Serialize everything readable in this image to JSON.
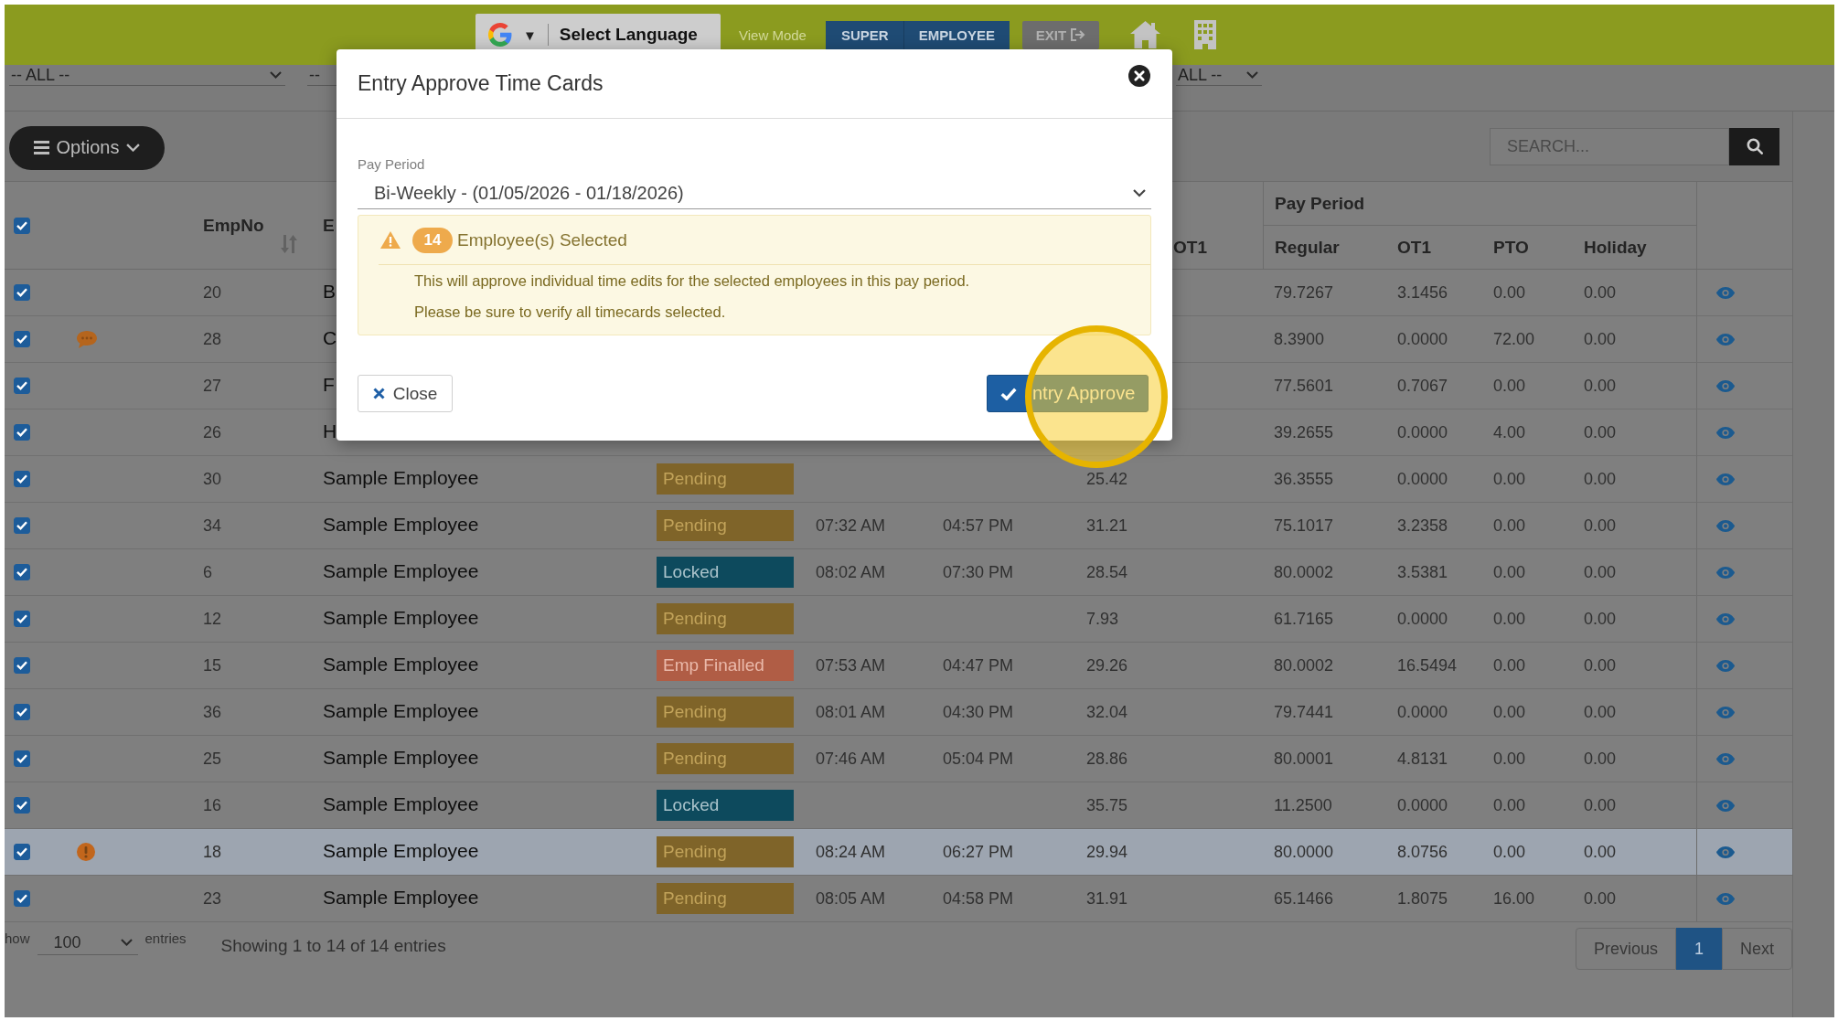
{
  "top_bar": {
    "language_select": {
      "caret": "▼",
      "label": "Select Language"
    },
    "view_mode": {
      "label": "View Mode",
      "options": [
        "SUPER",
        "EMPLOYEE"
      ]
    },
    "exit_button": "EXIT"
  },
  "filters": [
    {
      "value": "-- ALL --",
      "caret": true
    },
    {
      "value": "--",
      "caret": false
    },
    {
      "value": "ALL --",
      "caret": true
    }
  ],
  "toolbar": {
    "options_button": "Options",
    "search": {
      "placeholder": "SEARCH..."
    }
  },
  "table": {
    "select_all_checked": true,
    "headers": {
      "emp_no": "EmpNo",
      "employee": "E",
      "ot1": "OT1",
      "group": "Pay Period",
      "pay_period": [
        "Regular",
        "OT1",
        "PTO",
        "Holiday"
      ]
    },
    "rows": [
      {
        "checked": true,
        "highlighted": false,
        "emp_no": "20",
        "name": "B",
        "regular": "79.7267",
        "ot1": "3.1456",
        "pto": "0.00",
        "holiday": "0.00"
      },
      {
        "checked": true,
        "highlighted": false,
        "indicator": {
          "kind": "comment"
        },
        "emp_no": "28",
        "name": "C",
        "regular": "8.3900",
        "ot1": "0.0000",
        "pto": "72.00",
        "holiday": "0.00"
      },
      {
        "checked": true,
        "highlighted": false,
        "emp_no": "27",
        "name": "F",
        "regular": "77.5601",
        "ot1": "0.7067",
        "pto": "0.00",
        "holiday": "0.00"
      },
      {
        "checked": true,
        "highlighted": false,
        "emp_no": "26",
        "name": "H",
        "regular": "39.2655",
        "ot1": "0.0000",
        "pto": "4.00",
        "holiday": "0.00"
      },
      {
        "checked": true,
        "highlighted": false,
        "emp_no": "30",
        "name": "Sample Employee",
        "status": {
          "kind": "pending",
          "label": "Pending"
        },
        "hours": "25.42",
        "regular": "36.3555",
        "ot1": "0.0000",
        "pto": "0.00",
        "holiday": "0.00"
      },
      {
        "checked": true,
        "highlighted": false,
        "emp_no": "34",
        "name": "Sample Employee",
        "status": {
          "kind": "pending",
          "label": "Pending"
        },
        "time_in": "07:32 AM",
        "time_out": "04:57 PM",
        "hours": "31.21",
        "regular": "75.1017",
        "ot1": "3.2358",
        "pto": "0.00",
        "holiday": "0.00"
      },
      {
        "checked": true,
        "highlighted": false,
        "emp_no": "6",
        "name": "Sample Employee",
        "status": {
          "kind": "locked",
          "label": "Locked"
        },
        "time_in": "08:02 AM",
        "time_out": "07:30 PM",
        "hours": "28.54",
        "regular": "80.0002",
        "ot1": "3.5381",
        "pto": "0.00",
        "holiday": "0.00"
      },
      {
        "checked": true,
        "highlighted": false,
        "emp_no": "12",
        "name": "Sample Employee",
        "status": {
          "kind": "pending",
          "label": "Pending"
        },
        "hours": "7.93",
        "regular": "61.7165",
        "ot1": "0.0000",
        "pto": "0.00",
        "holiday": "0.00"
      },
      {
        "checked": true,
        "highlighted": false,
        "emp_no": "15",
        "name": "Sample Employee",
        "status": {
          "kind": "finalled",
          "label": "Emp Finalled"
        },
        "time_in": "07:53 AM",
        "time_out": "04:47 PM",
        "hours": "29.26",
        "regular": "80.0002",
        "ot1": "16.5494",
        "pto": "0.00",
        "holiday": "0.00"
      },
      {
        "checked": true,
        "highlighted": false,
        "emp_no": "36",
        "name": "Sample Employee",
        "status": {
          "kind": "pending",
          "label": "Pending"
        },
        "time_in": "08:01 AM",
        "time_out": "04:30 PM",
        "hours": "32.04",
        "regular": "79.7441",
        "ot1": "0.0000",
        "pto": "0.00",
        "holiday": "0.00"
      },
      {
        "checked": true,
        "highlighted": false,
        "emp_no": "25",
        "name": "Sample Employee",
        "status": {
          "kind": "pending",
          "label": "Pending"
        },
        "time_in": "07:46 AM",
        "time_out": "05:04 PM",
        "hours": "28.86",
        "regular": "80.0001",
        "ot1": "4.8131",
        "pto": "0.00",
        "holiday": "0.00"
      },
      {
        "checked": true,
        "highlighted": false,
        "emp_no": "16",
        "name": "Sample Employee",
        "status": {
          "kind": "locked",
          "label": "Locked"
        },
        "hours": "35.75",
        "regular": "11.2500",
        "ot1": "0.0000",
        "pto": "0.00",
        "holiday": "0.00"
      },
      {
        "checked": true,
        "highlighted": true,
        "indicator": {
          "kind": "alert"
        },
        "emp_no": "18",
        "name": "Sample Employee",
        "status": {
          "kind": "pending",
          "label": "Pending"
        },
        "time_in": "08:24 AM",
        "time_out": "06:27 PM",
        "hours": "29.94",
        "regular": "80.0000",
        "ot1": "8.0756",
        "pto": "0.00",
        "holiday": "0.00"
      },
      {
        "checked": true,
        "highlighted": false,
        "emp_no": "23",
        "name": "Sample Employee",
        "status": {
          "kind": "pending",
          "label": "Pending"
        },
        "time_in": "08:05 AM",
        "time_out": "04:58 PM",
        "hours": "31.91",
        "regular": "65.1466",
        "ot1": "1.8075",
        "pto": "16.00",
        "holiday": "0.00"
      }
    ]
  },
  "footer": {
    "show_label": "how",
    "page_size": "100",
    "entries_label": "entries",
    "info": "Showing 1 to 14 of 14 entries",
    "pagination": [
      {
        "label": "Previous",
        "selected": false
      },
      {
        "label": "1",
        "selected": true
      },
      {
        "label": "Next",
        "selected": false
      }
    ]
  },
  "modal": {
    "title": "Entry Approve Time Cards",
    "pay_period": {
      "label": "Pay Period",
      "value": "Bi-Weekly - (01/05/2026 - 01/18/2026)"
    },
    "warning": {
      "count": "14",
      "heading": "Employee(s) Selected",
      "lines": [
        "This will approve individual time edits for the selected employees in this pay period.",
        "Please be sure to verify all timecards selected."
      ]
    },
    "buttons": [
      {
        "kind": "close",
        "label": "Close"
      },
      {
        "kind": "approve",
        "label": "ntry Approve"
      }
    ]
  }
}
